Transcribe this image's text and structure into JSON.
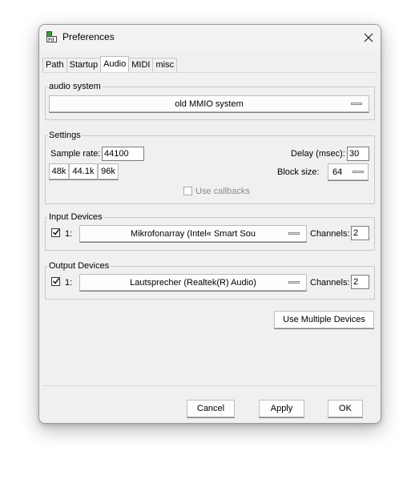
{
  "window": {
    "title": "Preferences",
    "icon_text": "Pd"
  },
  "tabs": [
    {
      "label": "Path",
      "active": false
    },
    {
      "label": "Startup",
      "active": false
    },
    {
      "label": "Audio",
      "active": true
    },
    {
      "label": "MIDI",
      "active": false
    },
    {
      "label": "misc",
      "active": false
    }
  ],
  "audio_system": {
    "title": "audio system",
    "selected": "old MMIO system"
  },
  "settings": {
    "title": "Settings",
    "sample_rate_label": "Sample rate:",
    "sample_rate_value": "44100",
    "delay_label": "Delay (msec):",
    "delay_value": "30",
    "rate_buttons": [
      "48k",
      "44.1k",
      "96k"
    ],
    "block_size_label": "Block size:",
    "block_size_value": "64",
    "use_callbacks_label": "Use callbacks",
    "use_callbacks_checked": false
  },
  "input_devices": {
    "title": "Input Devices",
    "checked": true,
    "index": "1:",
    "device": "Mikrofonarray (Intel« Smart Sou",
    "channels_label": "Channels:",
    "channels_value": "2"
  },
  "output_devices": {
    "title": "Output Devices",
    "checked": true,
    "index": "1:",
    "device": "Lautsprecher (Realtek(R) Audio)",
    "channels_label": "Channels:",
    "channels_value": "2"
  },
  "multi_devices_label": "Use Multiple Devices",
  "footer": {
    "cancel": "Cancel",
    "apply": "Apply",
    "ok": "OK"
  }
}
